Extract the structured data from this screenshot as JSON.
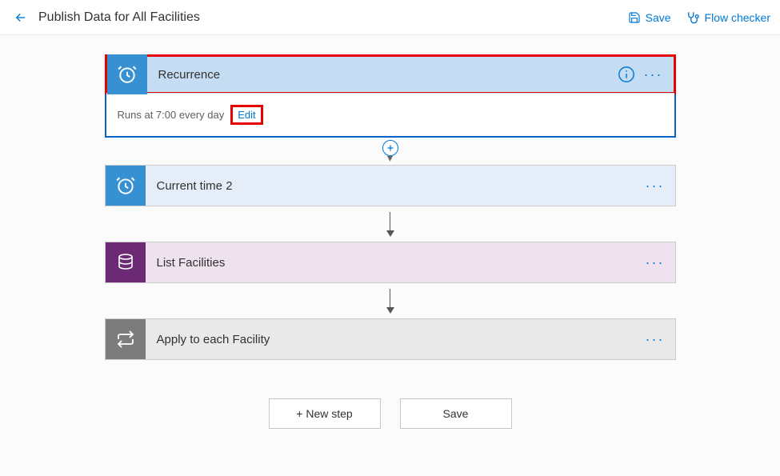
{
  "header": {
    "title": "Publish Data for All Facilities",
    "save_label": "Save",
    "flow_checker_label": "Flow checker"
  },
  "steps": {
    "recurrence": {
      "title": "Recurrence",
      "schedule_text": "Runs at 7:00 every day",
      "edit_label": "Edit"
    },
    "current_time": {
      "title": "Current time 2"
    },
    "list_facilities": {
      "title": "List Facilities"
    },
    "apply_each": {
      "title": "Apply to each Facility"
    }
  },
  "bottom": {
    "new_step_label": "+ New step",
    "save_label": "Save"
  }
}
